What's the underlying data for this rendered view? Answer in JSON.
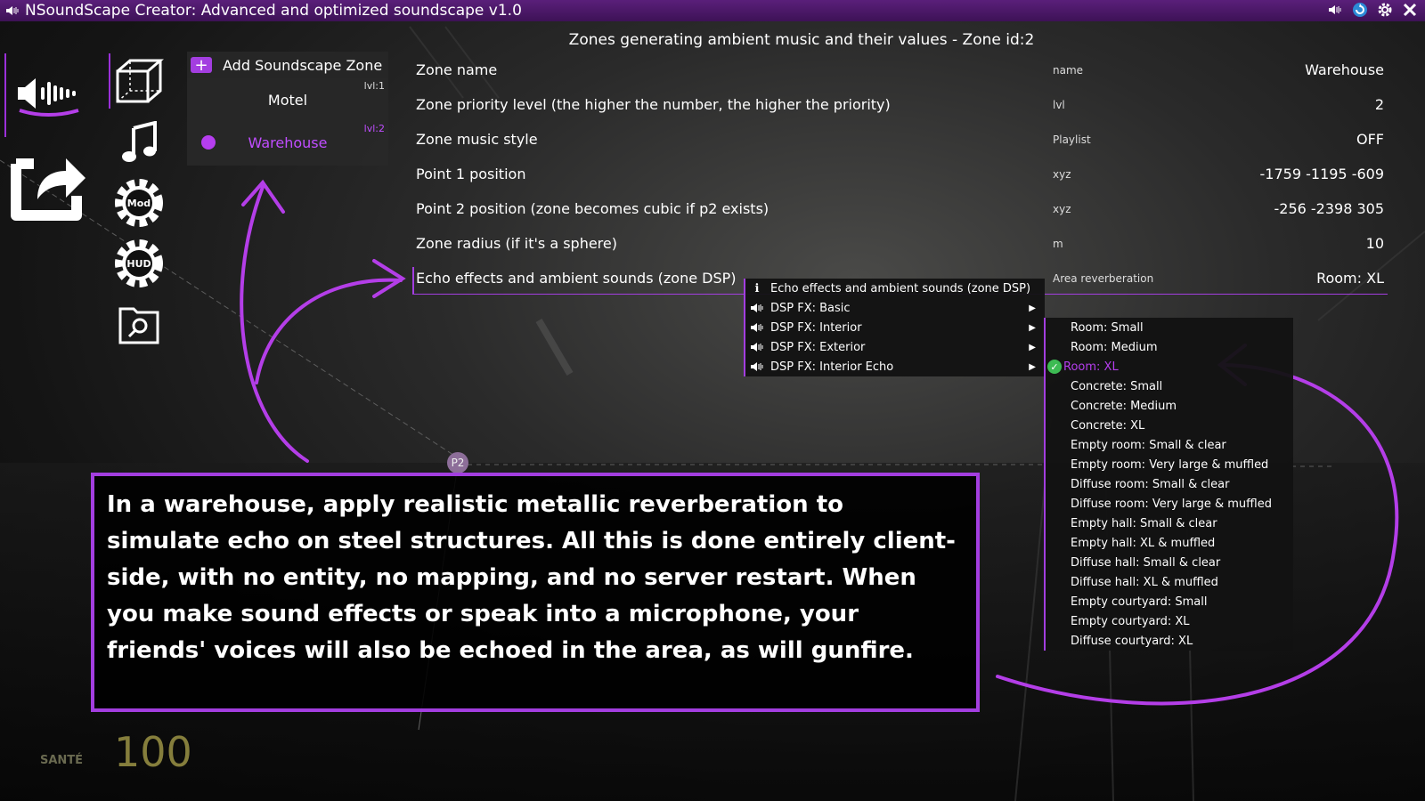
{
  "window": {
    "title": "NSoundScape Creator: Advanced and optimized soundscape v1.0"
  },
  "zones_panel": {
    "add_label": "Add Soundscape Zone",
    "zones": [
      {
        "name": "Motel",
        "level": "lvl:1"
      },
      {
        "name": "Warehouse",
        "level": "lvl:2"
      }
    ]
  },
  "header": "Zones generating ambient music and their values - Zone id:2",
  "properties": [
    {
      "label": "Zone name",
      "key": "name",
      "value": "Warehouse"
    },
    {
      "label": "Zone priority level (the higher the number, the higher the priority)",
      "key": "lvl",
      "value": "2"
    },
    {
      "label": "Zone music style",
      "key": "Playlist",
      "value": "OFF"
    },
    {
      "label": "Point 1 position",
      "key": "xyz",
      "value": "-1759 -1195 -609"
    },
    {
      "label": "Point 2 position (zone becomes cubic if p2 exists)",
      "key": "xyz",
      "value": "-256 -2398 305"
    },
    {
      "label": "Zone radius (if it's a sphere)",
      "key": "m",
      "value": "10"
    },
    {
      "label": "Echo effects and ambient sounds (zone DSP)",
      "key": "Area reverberation",
      "value": "Room: XL"
    }
  ],
  "dsp_menu": {
    "info": "Echo effects and ambient sounds (zone DSP)",
    "items": [
      "DSP FX: Basic",
      "DSP FX: Interior",
      "DSP FX: Exterior",
      "DSP FX: Interior Echo"
    ]
  },
  "presets_menu": {
    "items": [
      "Room: Small",
      "Room: Medium",
      "Room: XL",
      "Concrete: Small",
      "Concrete: Medium",
      "Concrete: XL",
      "Empty room: Small & clear",
      "Empty room: Very large & muffled",
      "Diffuse room: Small & clear",
      "Diffuse room: Very large & muffled",
      "Empty hall: Small & clear",
      "Empty hall: XL & muffled",
      "Diffuse hall: Small & clear",
      "Diffuse hall: XL & muffled",
      "Empty courtyard: Small",
      "Empty courtyard: XL",
      "Diffuse courtyard: XL"
    ],
    "selected": "Room: XL"
  },
  "callout": "In a warehouse, apply realistic metallic reverberation to simulate echo on steel structures. All this is done entirely client-side, with no entity, no mapping, and no server restart. When you make sound effects or speak into a microphone, your friends' voices will also be echoed in the area, as will gunfire.",
  "marker": "P2",
  "hud": {
    "label": "SANTÉ",
    "value": "100"
  },
  "icons": {
    "left": [
      "sound-wave-icon",
      "export-icon"
    ],
    "column": [
      "cube-icon",
      "music-note-icon",
      "mod-gear-icon",
      "hud-gear-icon",
      "file-search-icon"
    ]
  },
  "colors": {
    "accent": "#a33ee0",
    "titlebar": "#4a1868",
    "selected_text": "#b63eef",
    "check": "#3dbb53"
  }
}
